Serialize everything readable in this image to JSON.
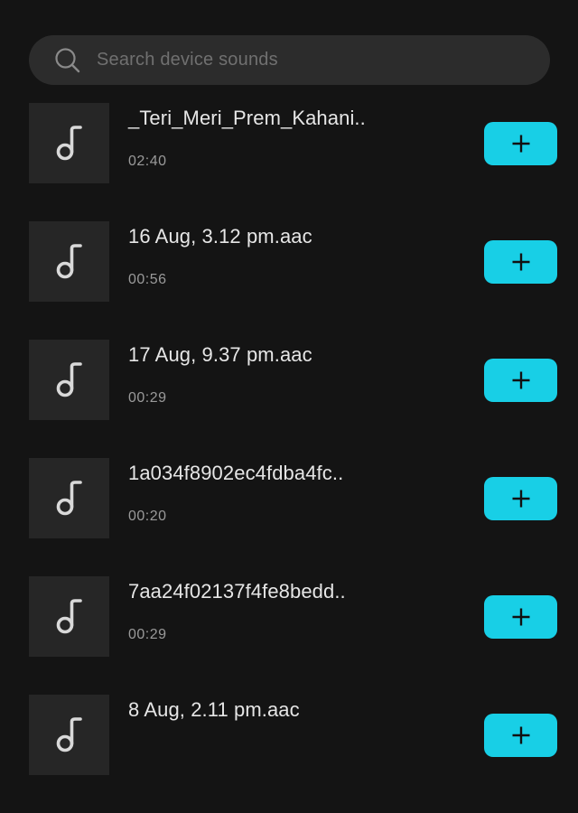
{
  "search": {
    "placeholder": "Search device sounds",
    "value": ""
  },
  "sounds": [
    {
      "title": "_Teri_Meri_Prem_Kahani..",
      "duration": "02:40"
    },
    {
      "title": "16 Aug, 3.12 pm.aac",
      "duration": "00:56"
    },
    {
      "title": "17 Aug, 9.37 pm.aac",
      "duration": "00:29"
    },
    {
      "title": "1a034f8902ec4fdba4fc..",
      "duration": "00:20"
    },
    {
      "title": "7aa24f02137f4fe8bedd..",
      "duration": "00:29"
    },
    {
      "title": "8 Aug, 2.11 pm.aac",
      "duration": ""
    }
  ],
  "icons": {
    "search": "search-icon",
    "thumbnail": "music-note-icon",
    "add": "plus-icon"
  },
  "colors": {
    "background": "#141414",
    "search_bg": "#2c2c2c",
    "thumb_bg": "#262626",
    "accent": "#18cfe6",
    "title_text": "#e6e6e6",
    "duration_text": "#9a9a9a"
  }
}
